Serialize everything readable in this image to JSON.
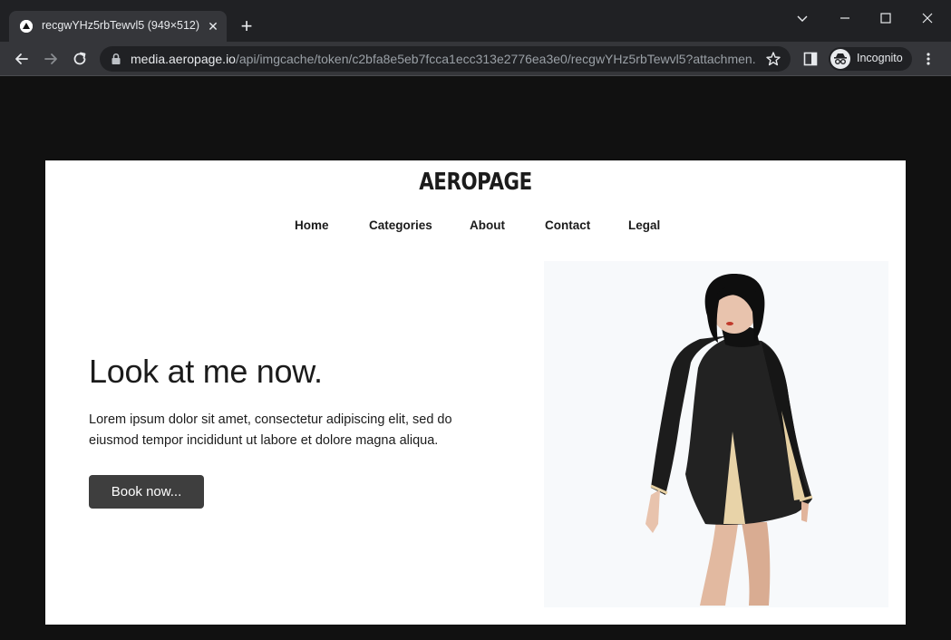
{
  "browser": {
    "tab": {
      "title": "recgwYHz5rbTewvl5 (949×512)"
    },
    "url": {
      "host": "media.aeropage.io",
      "path": "/api/imgcache/token/c2bfa8e5eb7fcca1ecc313e2776ea3e0/recgwYHz5rbTewvl5?attachmen..."
    },
    "profile_label": "Incognito"
  },
  "site": {
    "logo": "AEROPAGE",
    "nav": [
      "Home",
      "Categories",
      "About",
      "Contact",
      "Legal"
    ],
    "hero": {
      "title": "Look at me now.",
      "body": "Lorem ipsum dolor sit amet, consectetur adipiscing elit, sed do eiusmod tempor incididunt ut labore et dolore magna aliqua.",
      "cta": "Book now..."
    }
  },
  "colors": {
    "chrome_dark": "#202124",
    "chrome_tab": "#35363a",
    "page_bg": "#ffffff",
    "button_bg": "#3e3e3e",
    "text": "#1b1b1b"
  }
}
